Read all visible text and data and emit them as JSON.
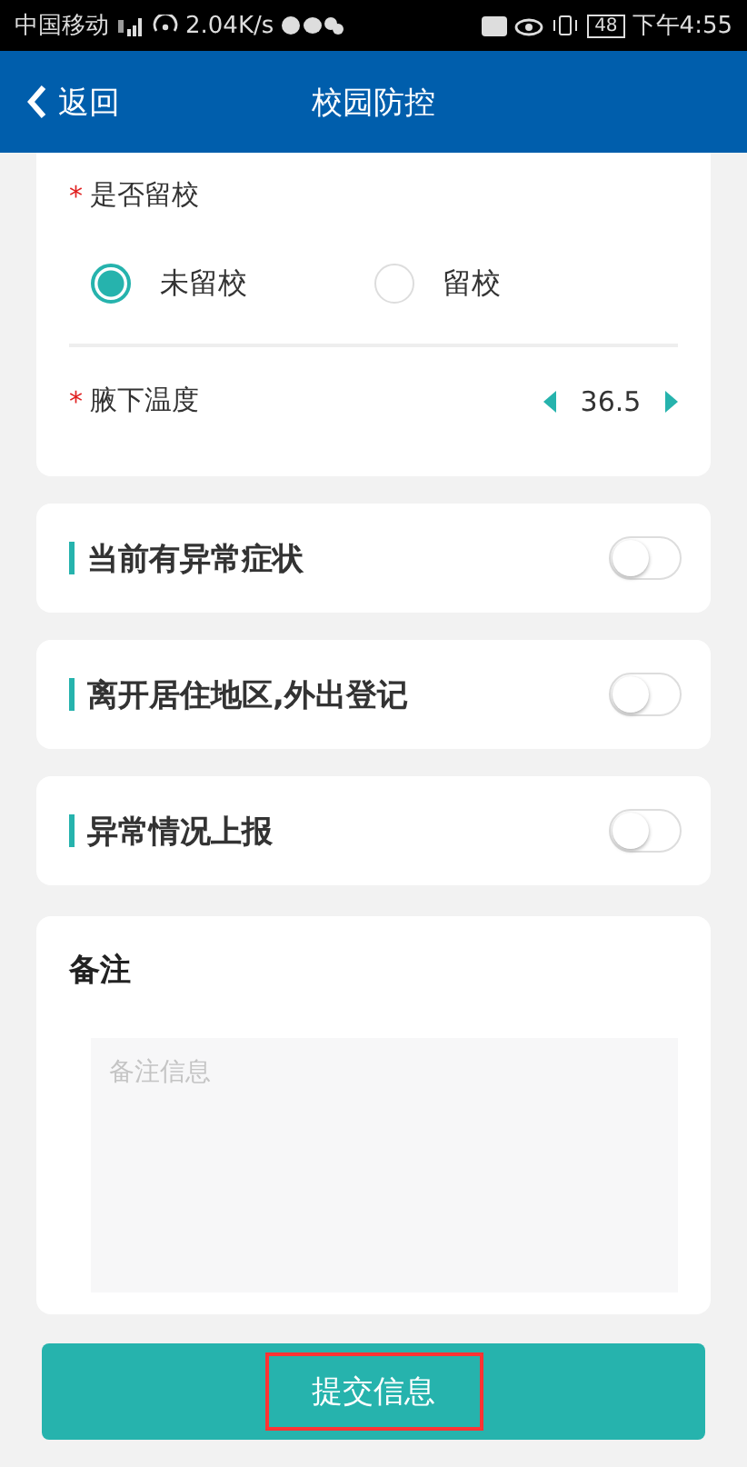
{
  "status_bar": {
    "carrier": "中国移动",
    "speed": "2.04K/s",
    "battery": "48",
    "time": "下午4:55"
  },
  "header": {
    "back": "返回",
    "title": "校园防控"
  },
  "stay": {
    "label": "是否留校",
    "required_mark": "*",
    "options": [
      {
        "label": "未留校",
        "selected": true
      },
      {
        "label": "留校",
        "selected": false
      }
    ]
  },
  "temperature": {
    "label": "腋下温度",
    "required_mark": "*",
    "value": "36.5"
  },
  "toggles": [
    {
      "label": "当前有异常症状",
      "on": false
    },
    {
      "label": "离开居住地区,外出登记",
      "on": false
    },
    {
      "label": "异常情况上报",
      "on": false
    }
  ],
  "remark": {
    "title": "备注",
    "placeholder": "备注信息"
  },
  "submit": {
    "label": "提交信息",
    "highlighted": true
  }
}
